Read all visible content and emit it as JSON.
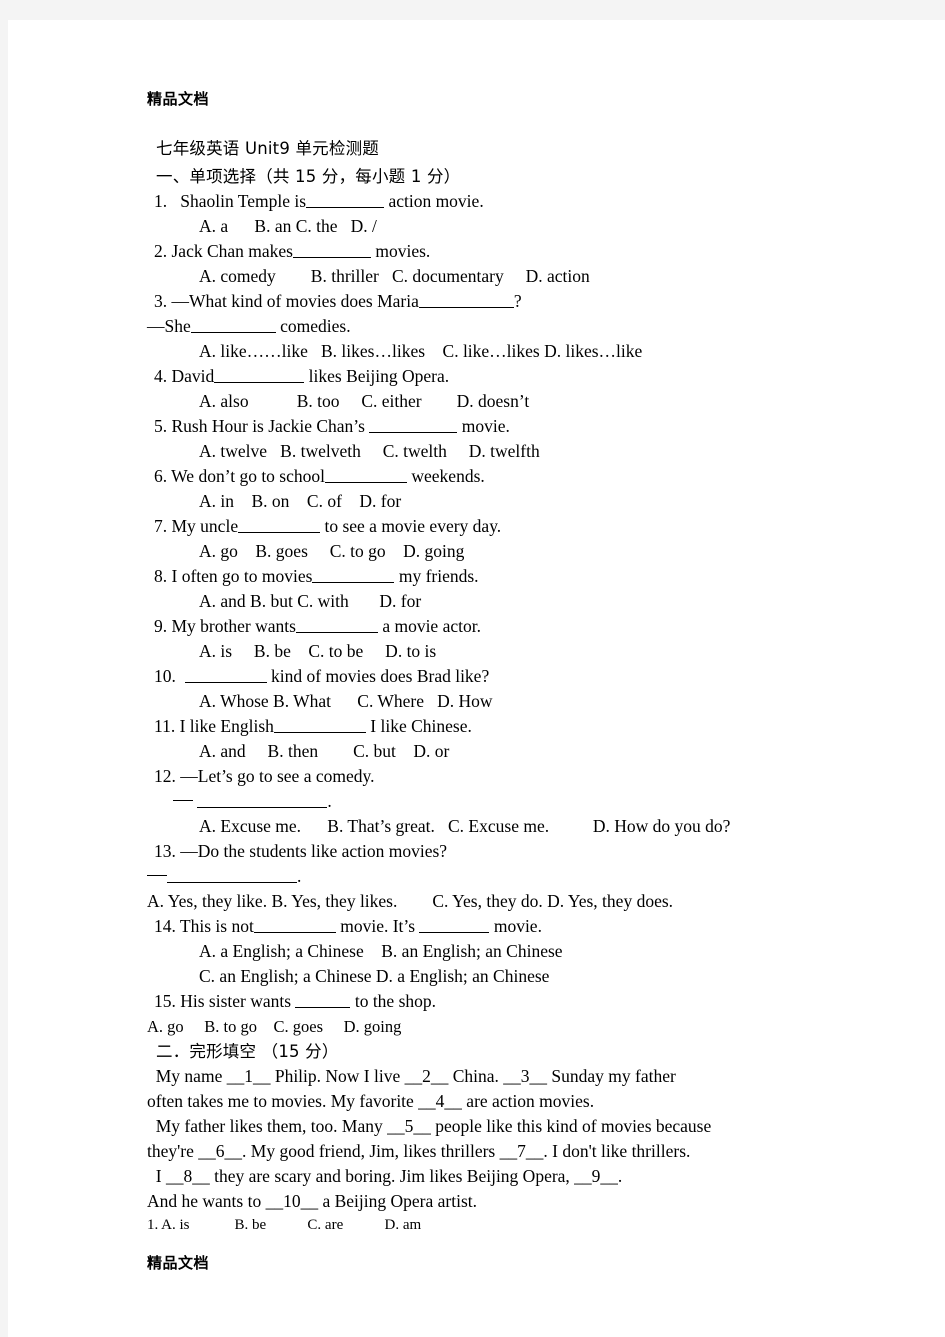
{
  "document": {
    "header_watermark": "精品文档",
    "footer_watermark": "精品文档",
    "title": "七年级英语 Unit9 单元检测题",
    "section1_heading": "一、单项选择（共 15 分，每小题 1 分）",
    "section2_heading": "二．完形填空 （15 分）"
  },
  "section1": {
    "questions": [
      {
        "stem_before": "1.   Shaolin Temple is",
        "blank": 78,
        "stem_after": " action movie.",
        "options": "A. a      B. an C. the   D. /"
      },
      {
        "stem_before": "2. Jack Chan makes",
        "blank": 78,
        "stem_after": " movies.",
        "options": "A. comedy        B. thriller   C. documentary     D. action"
      },
      {
        "stem_before": "3. —What kind of movies does Maria",
        "blank": 95,
        "stem_after": "?",
        "continuation_before": "—She",
        "continuation_blank": 85,
        "continuation_after": " comedies.",
        "options": "A. like……like   B. likes…likes    C. like…likes D. likes…like"
      },
      {
        "stem_before": "4. David",
        "blank": 90,
        "stem_after": " likes Beijing Opera.",
        "options": "A. also           B. too     C. either        D. doesn’t"
      },
      {
        "stem_before": "5. Rush Hour is Jackie Chan’s ",
        "blank": 88,
        "stem_after": " movie.",
        "options": "A. twelve   B. twelveth     C. twelth     D. twelfth"
      },
      {
        "stem_before": "6. We don’t go to school",
        "blank": 82,
        "stem_after": " weekends.",
        "options": "A. in    B. on    C. of    D. for"
      },
      {
        "stem_before": "7. My uncle",
        "blank": 82,
        "stem_after": " to see a movie every day.",
        "options": "A. go    B. goes     C. to go    D. going"
      },
      {
        "stem_before": "8. I often go to movies",
        "blank": 82,
        "stem_after": " my friends.",
        "options": "A. and B. but C. with       D. for"
      },
      {
        "stem_before": "9. My brother wants",
        "blank": 82,
        "stem_after": " a movie actor.",
        "options": "A. is     B. be    C. to be     D. to is"
      },
      {
        "stem_before": "10.  ",
        "blank": 82,
        "stem_after": " kind of movies does Brad like?",
        "options": "A. Whose B. What      C. Where   D. How"
      },
      {
        "stem_before": "11. I like English",
        "blank": 92,
        "stem_after": " I like Chinese.",
        "options": "A. and     B. then        C. but    D. or"
      },
      {
        "stem_before": "12. —Let’s go to see a comedy.",
        "blank": 0,
        "stem_after": "",
        "answer_line_blank": 130,
        "answer_line_after": ".",
        "options": "A. Excuse me.      B. That’s great.   C. Excuse me.          D. How do you do?"
      },
      {
        "stem_before": "13. —Do the students like action movies?",
        "blank": 0,
        "stem_after": "",
        "answer_line_blank": 130,
        "answer_line_after": ".",
        "options": "A. Yes, they like. B. Yes, they likes.        C. Yes, they do. D. Yes, they does."
      },
      {
        "stem_before": "14. This is not",
        "blank": 82,
        "stem_after": " movie. It’s ",
        "blank2": 70,
        "stem_after2": " movie.",
        "options": "A. a English; a Chinese    B. an English; an Chinese",
        "options2": "C. an English; a Chinese D. a English; an Chinese"
      },
      {
        "stem_before": "15. His sister wants ",
        "blank": 55,
        "stem_after": " to the shop.",
        "options": "A. go     B. to go    C. goes     D. going"
      }
    ]
  },
  "section2": {
    "passage": [
      "  My name __1__ Philip. Now I live __2__ China. __3__ Sunday my father",
      "often takes me to movies. My favorite __4__ are action movies.",
      "  My father likes them, too. Many __5__ people like this kind of movies because",
      "they're __6__. My good friend, Jim, likes thrillers __7__. I don't like thrillers.",
      "  I __8__ they are scary and boring. Jim likes Beijing Opera, __9__.",
      "And he wants to __10__ a Beijing Opera artist."
    ],
    "first_option_line": "1. A. is            B. be           C. are           D. am"
  }
}
